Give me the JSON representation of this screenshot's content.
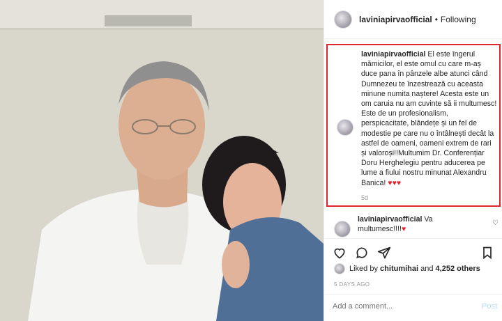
{
  "post": {
    "username": "laviniapirvaofficial",
    "separator": "•",
    "follow_status": "Following"
  },
  "caption": {
    "username": "laviniapirvaofficial",
    "text": "El este îngerul mămicilor, el este omul cu care m-aș duce pana în pânzele albe atunci când Dumnezeu te înzestrează cu aceasta minune numita naștere! Acesta este un om caruia nu am cuvinte să ii multumesc! Este de un profesionalism, perspicacitate, blândețe și un fel de modestie pe care nu o întâlnești decât la astfel de oameni, oameni extrem de rari și valoroși!!Multumim Dr. Conferențiar Doru Herghelegiu pentru aducerea pe lume a fiului nostru minunat Alexandru Banica!",
    "hearts": "♥♥♥",
    "age": "5d"
  },
  "comment": {
    "username": "laviniapirvaofficial",
    "text": "Va multumesc!!!!",
    "heart": "♥"
  },
  "likes": {
    "prefix": "Liked by",
    "user": "chitumihai",
    "connector": "and",
    "others": "4,252 others"
  },
  "date": "5 DAYS AGO",
  "comment_box": {
    "placeholder": "Add a comment...",
    "post_label": "Post"
  },
  "icons": [
    "heart-outline-icon",
    "comment-icon",
    "share-icon",
    "bookmark-icon"
  ],
  "colors": {
    "highlight": "#e0252f",
    "post_disabled": "#b3dbff"
  }
}
